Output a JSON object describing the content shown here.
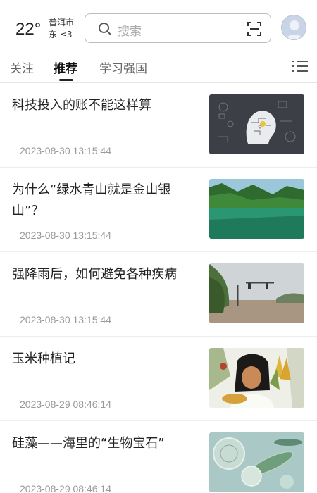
{
  "weather": {
    "temperature": "22°",
    "city": "普洱市",
    "wind": "东 ≤3"
  },
  "search": {
    "placeholder": "搜索",
    "icon": "search-icon",
    "scan_icon": "scan-icon"
  },
  "tabs": [
    {
      "label": "关注",
      "active": false
    },
    {
      "label": "推荐",
      "active": true
    },
    {
      "label": "学习强国",
      "active": false
    }
  ],
  "articles": [
    {
      "title": "科技投入的账不能这样算",
      "time": "2023-08-30 13:15:44",
      "thumb": "tech-head-image"
    },
    {
      "title": "为什么“绿水青山就是金山银山”？",
      "time": "2023-08-30 13:15:44",
      "thumb": "green-mountain-lake-image"
    },
    {
      "title": "强降雨后，如何避免各种疾病",
      "time": "2023-08-30 13:15:44",
      "thumb": "flooded-street-image"
    },
    {
      "title": "玉米种植记",
      "time": "2023-08-29 08:46:14",
      "thumb": "corn-farmer-painting-image"
    },
    {
      "title": "硅藻——海里的“生物宝石”",
      "time": "2023-08-29 08:46:14",
      "thumb": "diatom-image"
    }
  ],
  "colors": {
    "accent": "#222222",
    "muted": "#999999",
    "border": "#e6e6e6"
  }
}
